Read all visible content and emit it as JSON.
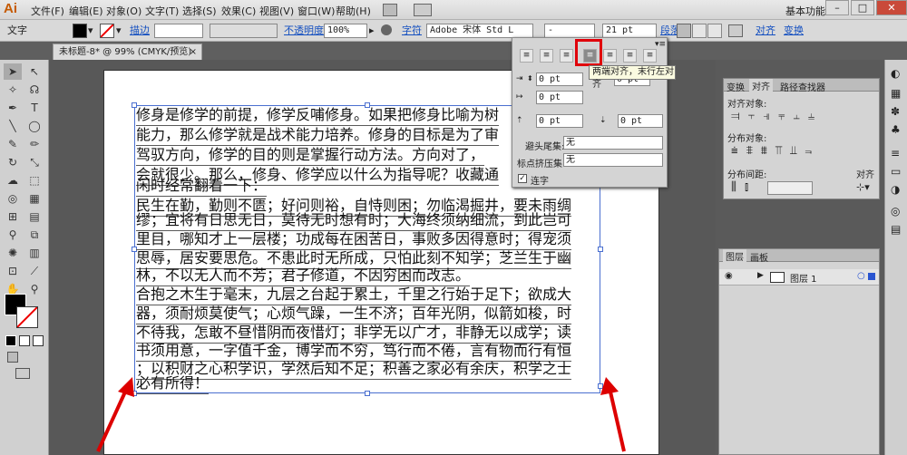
{
  "app": {
    "logo": "Ai",
    "workspace": "基本功能",
    "search_icon": "search-icon"
  },
  "menubar": [
    "文件(F)",
    "编辑(E)",
    "对象(O)",
    "文字(T)",
    "选择(S)",
    "效果(C)",
    "视图(V)",
    "窗口(W)",
    "帮助(H)"
  ],
  "window_controls": {
    "minimize": "–",
    "restore": "□",
    "close": "✕"
  },
  "control_bar": {
    "label_text": "文字",
    "stroke_label": "描边",
    "opacity_label": "不透明度",
    "opacity_value": "100%",
    "char_label": "字符",
    "font_name": "Adobe 宋体 Std L",
    "font_style": "-",
    "font_size": "21 pt",
    "para_label": "段落",
    "align_label": "对齐",
    "transform_label": "变换"
  },
  "document_tab": {
    "title": "未标题-8* @ 99% (CMYK/预览)",
    "close": "×"
  },
  "text_lines": [
    "修身是修学的前提，修学反哺修身。如果把修身比喻为树",
    "能力，那么修学就是战术能力培养。修身的目标是为了审",
    "驾驭方向，修学的目的则是掌握行动方法。方向对了，",
    "会就很少。那么，修身、修学应以什么为指导呢？收藏通",
    "闲时经常翻看一下：",
    "民生在勤，勤则不匮；好问则裕，自恃则困；勿临渴掘井，要未雨绸",
    "缪；宜将有日思无日，莫待无时想有时；大海终须纳细流，到此岂可",
    "里目，哪知才上一层楼；功成每在困苦日，事败多因得意时；得宠须",
    "思辱，居安要思危。不患此时无所成，只怕此刻不知学；芝兰生于幽",
    "林，不以无人而不芳；君子修道，不因穷困而改志。",
    "合抱之木生于毫末，九层之台起于累土，千里之行始于足下；欲成大",
    "器，须耐烦莫使气；心烦气躁，一生不济；百年光阴，似箭如梭，时",
    "不待我，怎敢不昼惜阴而夜惜灯；非学无以广才，非静无以成学；读",
    "书须用意，一字值千金，博学而不穷，笃行而不倦，言有物而行有恒",
    "；以积财之心积学识，学然后知不足；积善之家必有余庆，积学之士",
    "必有所得！"
  ],
  "paragraph_panel": {
    "indent_left": "0 pt",
    "indent_right": "0 pt",
    "first_indent": "0 pt",
    "space_before": "0 pt",
    "space_after": "0 pt",
    "kinsoku_label": "避头尾集:",
    "kinsoku_value": "无",
    "mojikumi_label": "标点挤压集:",
    "mojikumi_value": "无",
    "hyphen_label": "连字",
    "tooltip": "两端对齐，末行左对齐"
  },
  "align_panel": {
    "tabs": [
      "变换",
      "对齐",
      "路径查找器"
    ],
    "align_objects": "对齐对象:",
    "distribute_objects": "分布对象:",
    "distribute_spacing": "分布间距:",
    "align_to": "对齐"
  },
  "layers_panel": {
    "tabs": [
      "图层",
      "画板"
    ],
    "layer_name": "图层 1"
  }
}
